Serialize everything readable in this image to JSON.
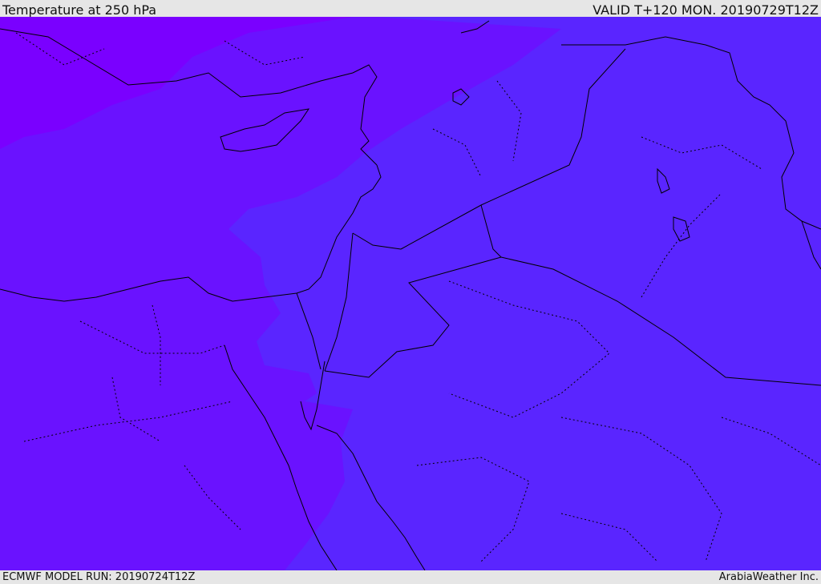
{
  "header": {
    "title": "Temperature at 250 hPa",
    "valid": "VALID T+120 MON. 20190729T12Z"
  },
  "footer": {
    "model_run": "ECMWF MODEL RUN: 20190724T12Z",
    "credit": "ArabiaWeather Inc."
  },
  "map": {
    "colors": {
      "coldest": "#7a00ff",
      "cold": "#6a12ff",
      "mid": "#5a25ff",
      "border": "#000000"
    }
  }
}
